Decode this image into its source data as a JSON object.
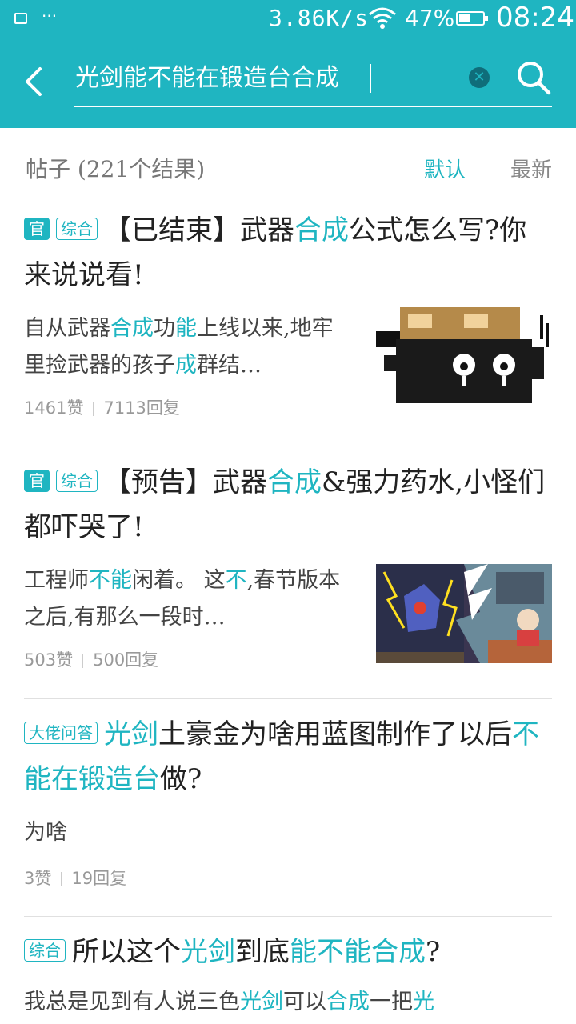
{
  "status": {
    "dots": "···",
    "speed": "3.86K/s",
    "battery_pct": "47%",
    "time": "08:24",
    "battery_level": 0.47
  },
  "search": {
    "query": "光剑能不能在锻造台合成"
  },
  "section": {
    "title": "帖子 (221个结果)",
    "sort_default": "默认",
    "sort_newest": "最新"
  },
  "colors": {
    "accent": "#1fb5c1",
    "text": "#222222",
    "muted": "#999999"
  },
  "icons": [
    "back-arrow-icon",
    "clear-icon",
    "search-icon",
    "wifi-icon",
    "battery-icon",
    "image-notification-icon"
  ],
  "posts": [
    {
      "tags": [
        "官",
        "综合"
      ],
      "title": [
        "【已结束】武器",
        "合成",
        "公式怎么写?你来说说看!"
      ],
      "body": [
        "自从武器",
        "合成",
        "功",
        "能",
        "上线以来,地牢里捡武器的孩子",
        "成",
        "群结…"
      ],
      "likes": "1461赞",
      "replies": "7113回复"
    },
    {
      "tags": [
        "官",
        "综合"
      ],
      "title": [
        "【预告】武器",
        "合成",
        "&强力药水,小怪们都吓哭了!"
      ],
      "body": [
        "工程师",
        "不能",
        "闲着。 这",
        "不",
        ",春节版本之后,有那么一段时…"
      ],
      "likes": "503赞",
      "replies": "500回复"
    },
    {
      "tags": [
        "大佬问答"
      ],
      "title": [
        "光剑",
        "土豪金为啥用蓝图制作了以后",
        "不能在锻造台",
        "做?"
      ],
      "body": [
        "为啥"
      ],
      "likes": "3赞",
      "replies": "19回复"
    },
    {
      "tags": [
        "综合"
      ],
      "title": [
        "所以这个",
        "光剑",
        "到底",
        "能不能合成",
        "?"
      ],
      "body": [
        "我总是见到有人说三色",
        "光剑",
        "可以",
        "合成",
        "一把",
        "光"
      ]
    }
  ]
}
